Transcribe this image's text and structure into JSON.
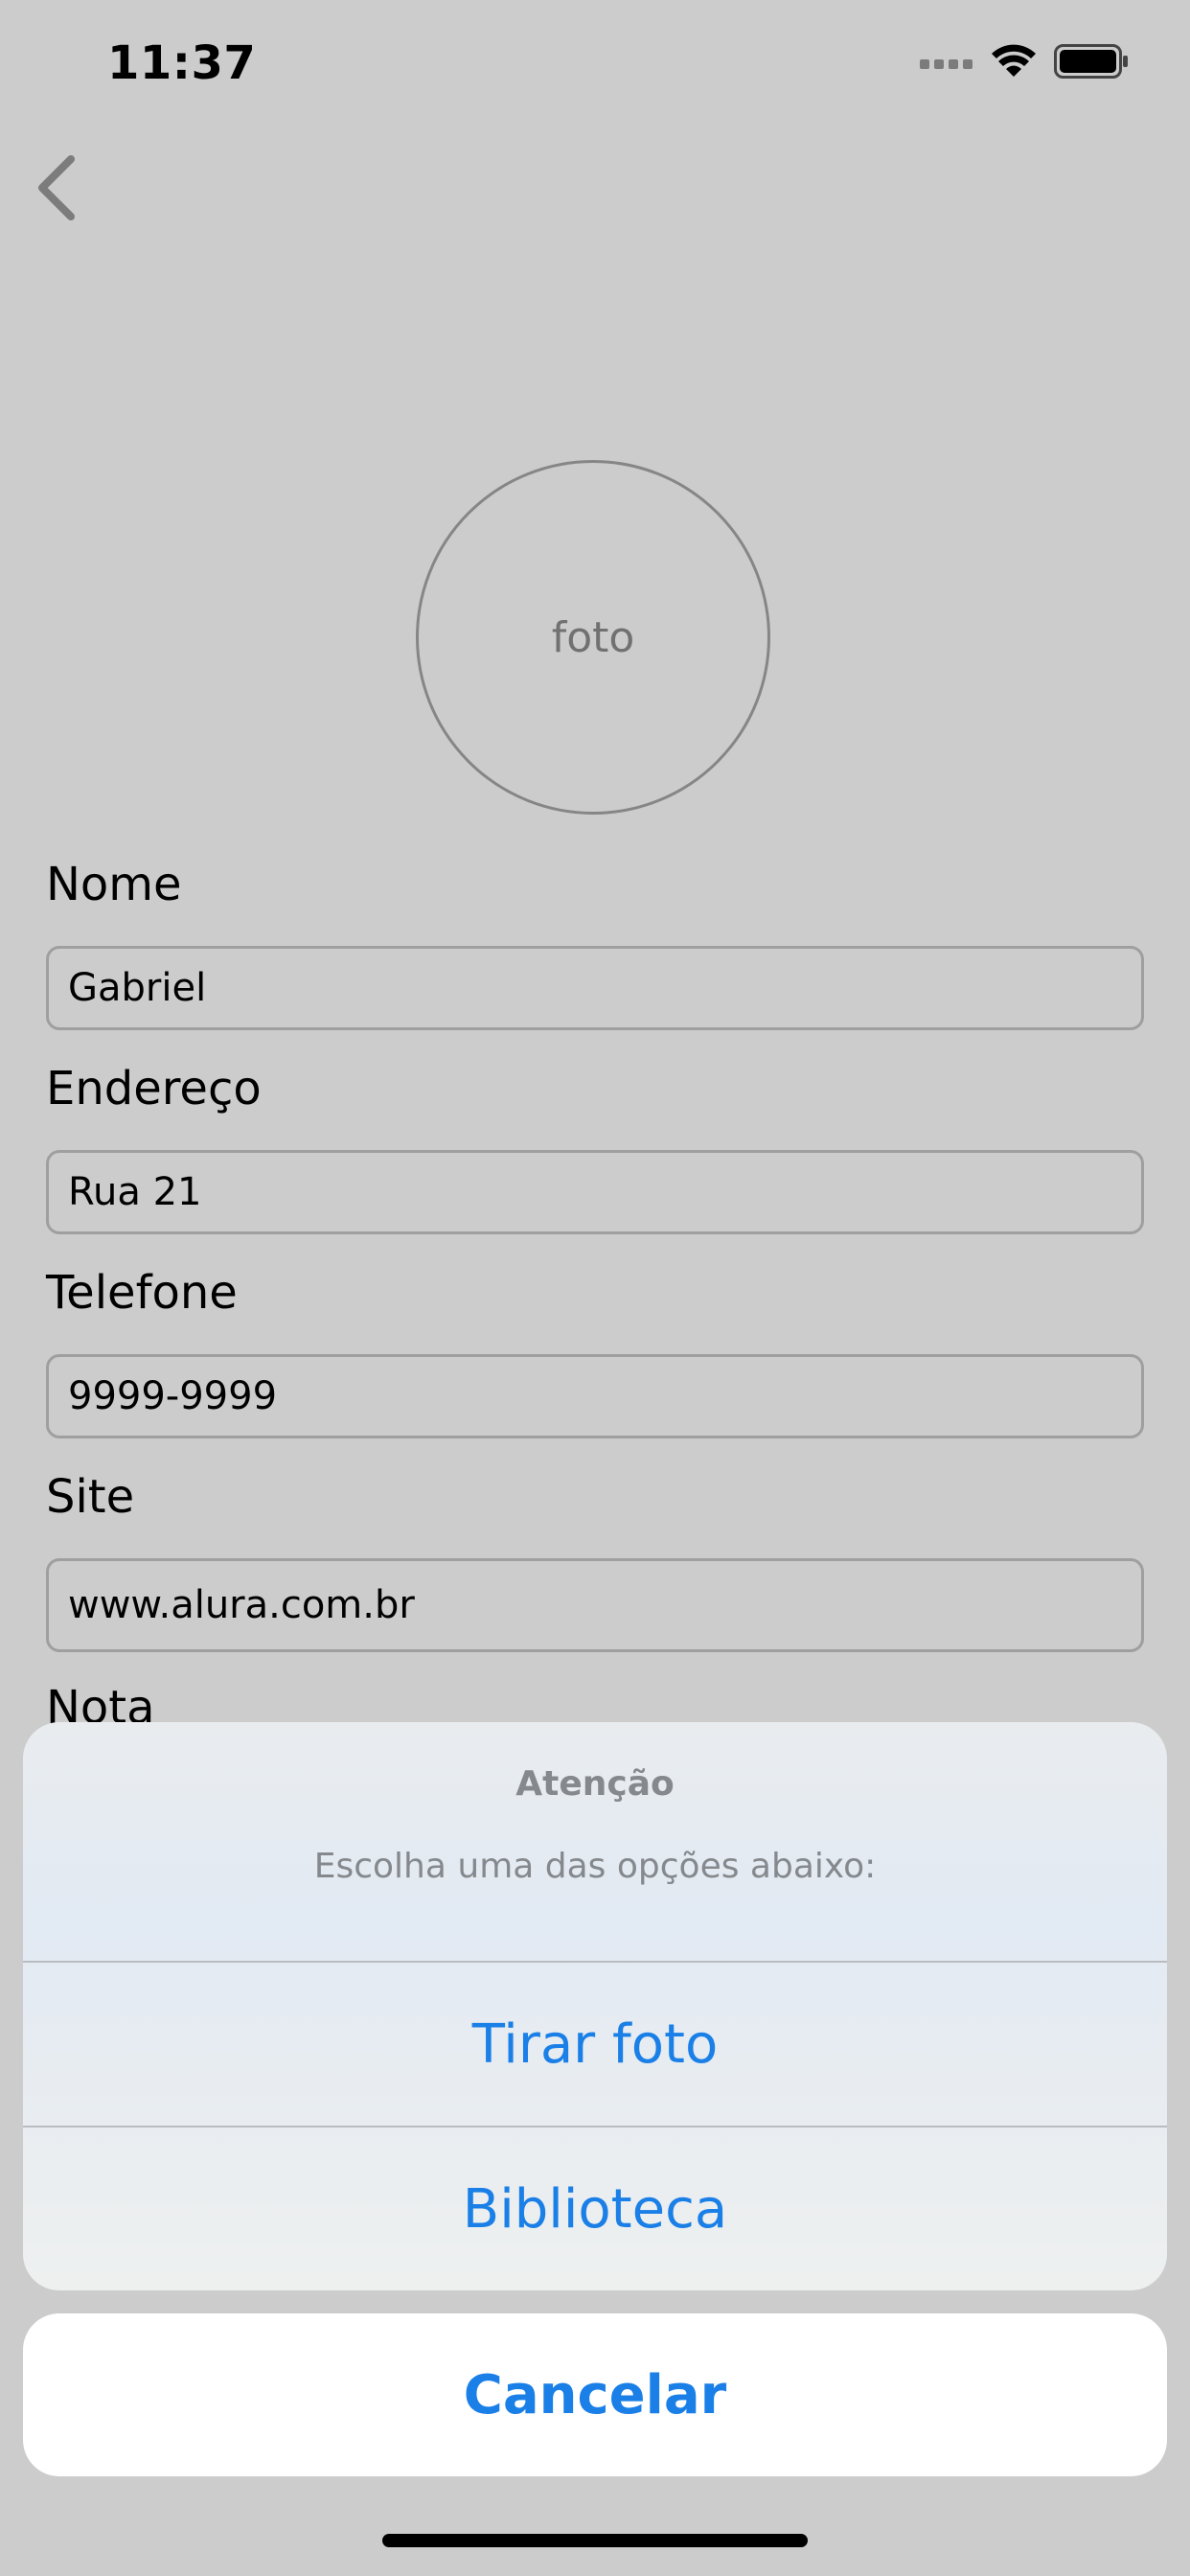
{
  "status_bar": {
    "time": "11:37",
    "icons": [
      "signal-icon",
      "wifi-icon",
      "battery-icon"
    ]
  },
  "nav": {
    "back_icon": "chevron-left-icon"
  },
  "photo": {
    "label": "foto"
  },
  "form": {
    "fields": [
      {
        "label": "Nome",
        "value": "Gabriel"
      },
      {
        "label": "Endereço",
        "value": "Rua 21"
      },
      {
        "label": "Telefone",
        "value": "9999-9999"
      },
      {
        "label": "Site",
        "value": "www.alura.com.br"
      },
      {
        "label": "Nota"
      }
    ]
  },
  "action_sheet": {
    "title": "Atenção",
    "message": "Escolha uma das opções abaixo:",
    "actions": [
      "Tirar foto",
      "Biblioteca"
    ],
    "cancel": "Cancelar"
  },
  "colors": {
    "accent": "#1a7fe6",
    "secondary_text": "#85898d",
    "overlay": "rgba(0,0,0,0.2)"
  }
}
